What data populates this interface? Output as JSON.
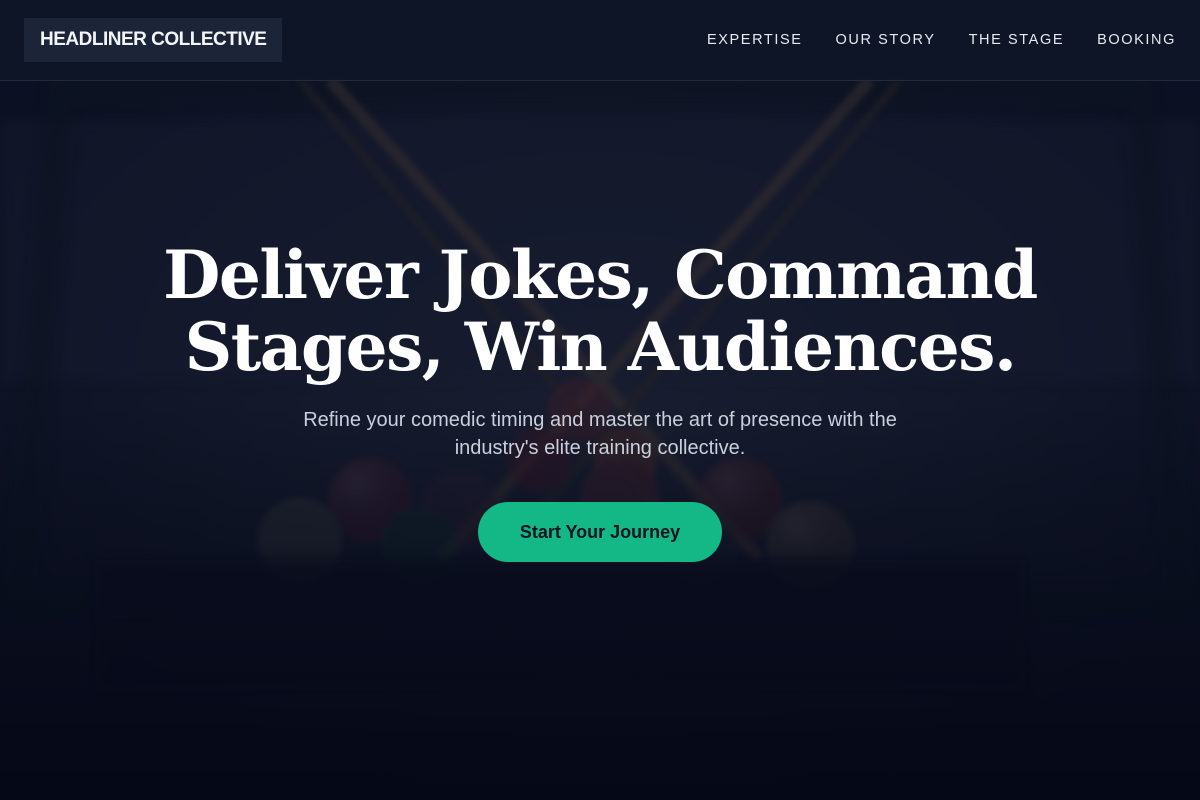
{
  "brand": {
    "name": "HEADLINER COLLECTIVE"
  },
  "nav": {
    "items": [
      {
        "label": "EXPERTISE"
      },
      {
        "label": "OUR STORY"
      },
      {
        "label": "THE STAGE"
      },
      {
        "label": "BOOKING"
      }
    ]
  },
  "hero": {
    "title_line1": "Deliver Jokes, Command",
    "title_line2": "Stages, Win Audiences.",
    "subtitle_line1": "Refine your comedic timing and master the art of presence with the",
    "subtitle_line2": "industry's elite training collective.",
    "cta_label": "Start Your Journey"
  },
  "colors": {
    "accent": "#13b886",
    "header_bg": "#0f1628",
    "page_bg": "#060a18",
    "text_primary": "#ffffff"
  }
}
